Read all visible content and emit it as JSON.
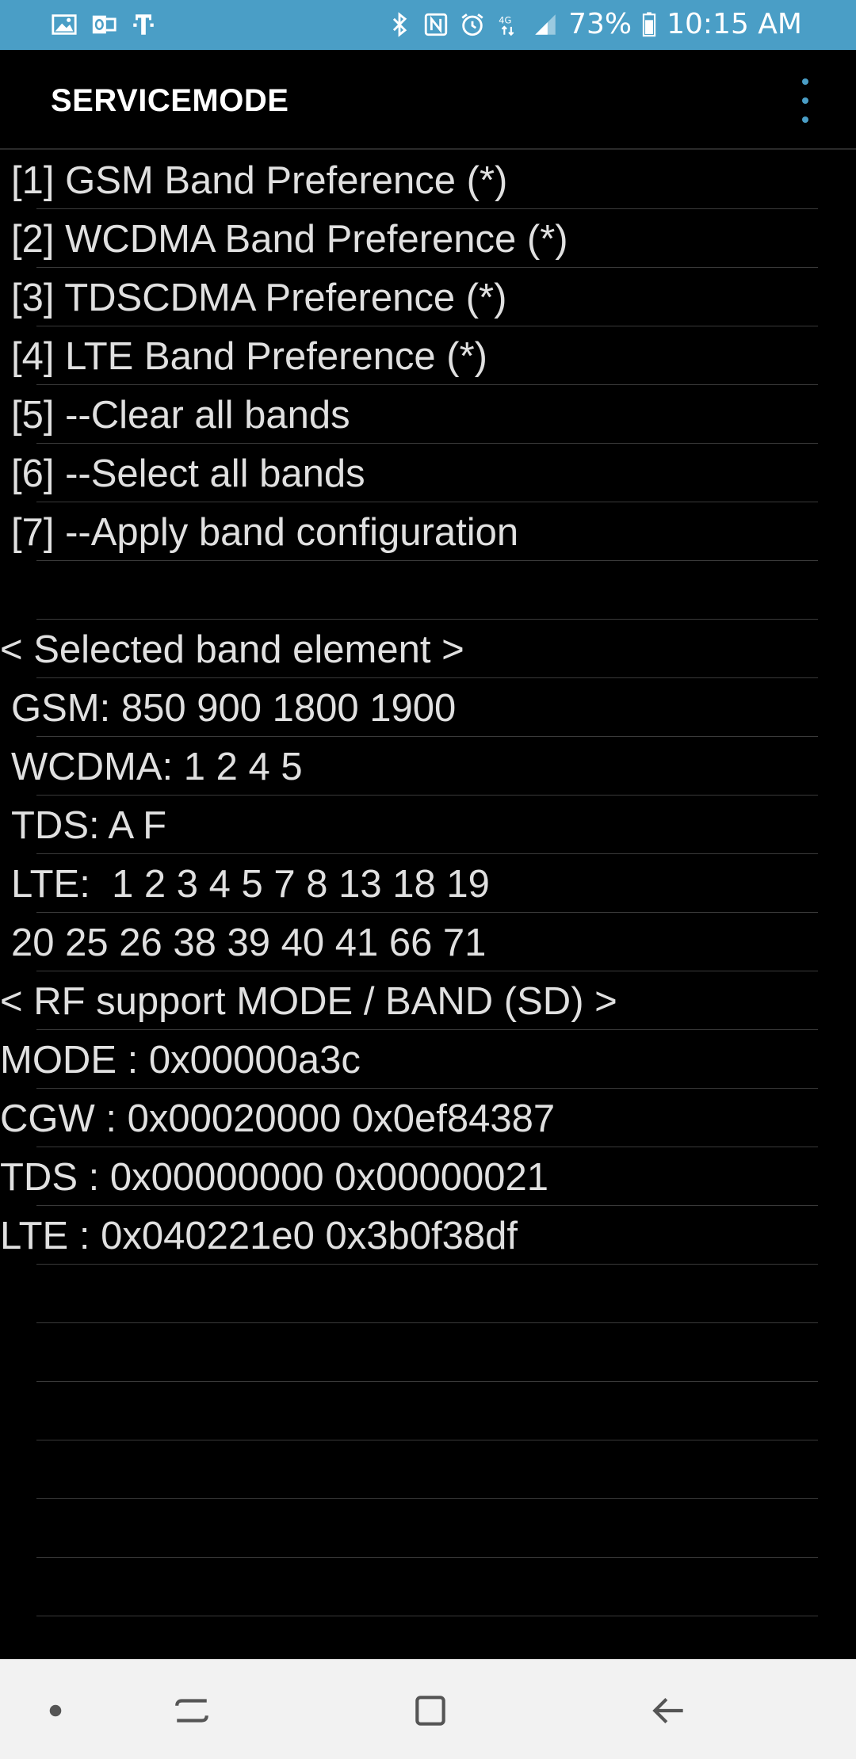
{
  "status_bar": {
    "battery": "73%",
    "time": "10:15 AM",
    "left_icons": [
      "gallery-icon",
      "outlook-icon",
      "tmobile-icon"
    ],
    "right_icons": [
      "bluetooth-icon",
      "nfc-icon",
      "alarm-icon",
      "data-icon",
      "signal-icon",
      "battery-icon"
    ]
  },
  "app_bar": {
    "title": "SERVICEMODE",
    "menu_icon": "more-vert-icon",
    "accent": "#4a9ec6"
  },
  "menu_items": [
    "[1] GSM Band Preference (*)",
    "[2] WCDMA Band Preference (*)",
    "[3] TDSCDMA Preference (*)",
    "[4] LTE Band Preference (*)",
    "[5] --Clear all bands",
    "[6] --Select all bands",
    "[7] --Apply band configuration"
  ],
  "info": {
    "selected_header": "< Selected band element >",
    "gsm": "GSM: 850 900 1800 1900",
    "wcdma": "WCDMA: 1 2 4 5",
    "tds": "TDS: A F",
    "lte": "LTE:  1 2 3 4 5 7 8 13 18 19",
    "lte_cont": "20 25 26 38 39 40 41 66 71",
    "rf_header": "< RF support MODE / BAND (SD) >",
    "mode": "MODE : 0x00000a3c",
    "cgw": "CGW : 0x00020000 0x0ef84387",
    "tds_rf": "TDS : 0x00000000 0x00000021",
    "lte_rf": "LTE : 0x040221e0 0x3b0f38df"
  },
  "nav_bar": {
    "icons": [
      "dot-icon",
      "recents-icon",
      "home-icon",
      "back-icon"
    ]
  }
}
